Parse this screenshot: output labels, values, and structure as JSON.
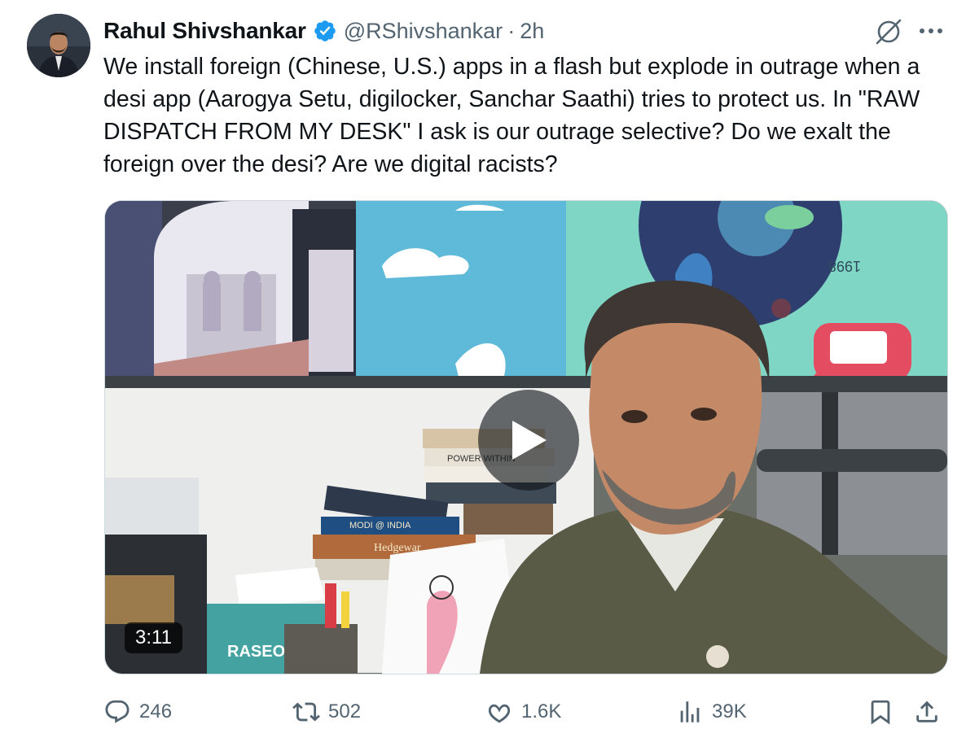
{
  "tweet": {
    "author_name": "Rahul Shivshankar",
    "handle": "@RShivshankar",
    "separator": "·",
    "time": "2h",
    "text": "We install foreign (Chinese, U.S.) apps in a flash but explode in outrage when a desi app (Aarogya Setu, digilocker, Sanchar Saathi) tries to protect us. In \"RAW DISPATCH FROM MY DESK\" I ask is our outrage selective? Do we exalt the foreign over the desi? Are we digital racists?",
    "verified": true
  },
  "media": {
    "type": "video",
    "duration": "3:11",
    "wall_number": "1998",
    "book_labels": [
      "POWER WITHIN",
      "MODI @ INDIA",
      "Hedgewar",
      "RASEO"
    ]
  },
  "actions": {
    "replies": "246",
    "reposts": "502",
    "likes": "1.6K",
    "views": "39K"
  },
  "icons": {
    "verified": "verified-badge-icon",
    "grok": "grok-icon",
    "more": "more-dots-icon",
    "play": "play-icon",
    "reply": "reply-icon",
    "repost": "repost-icon",
    "like": "heart-icon",
    "views": "views-chart-icon",
    "bookmark": "bookmark-icon",
    "share": "share-icon"
  },
  "colors": {
    "text": "#0f1419",
    "secondary": "#536471",
    "verified_blue": "#1d9bf0",
    "border": "#cfd9de"
  }
}
